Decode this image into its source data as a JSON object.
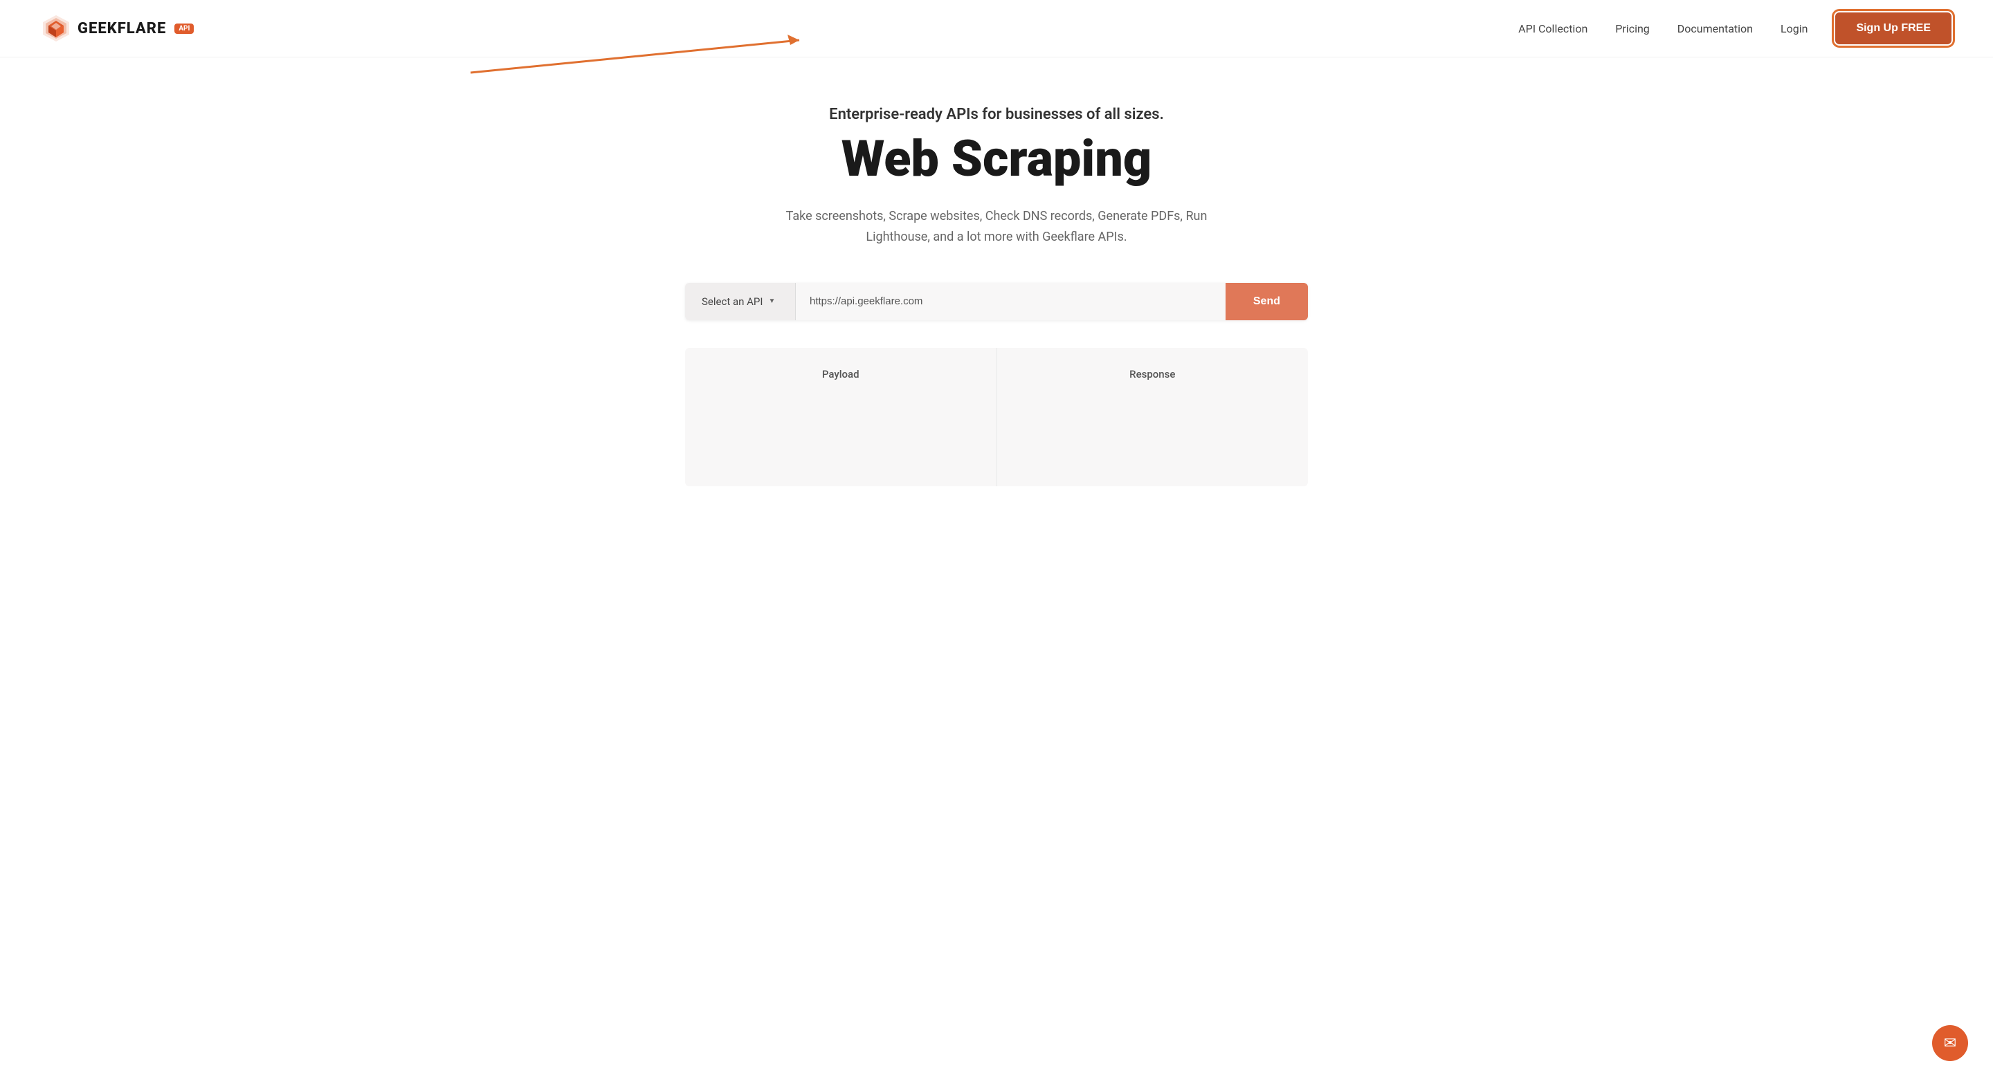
{
  "header": {
    "logo_text": "GEEKFLARE",
    "api_badge": "API",
    "nav": {
      "items": [
        {
          "label": "API Collection",
          "id": "api-collection"
        },
        {
          "label": "Pricing",
          "id": "pricing"
        },
        {
          "label": "Documentation",
          "id": "documentation"
        },
        {
          "label": "Login",
          "id": "login"
        }
      ],
      "signup_label": "Sign Up FREE"
    }
  },
  "hero": {
    "subtitle": "Enterprise-ready APIs for businesses of all sizes.",
    "title": "Web Scraping",
    "description": "Take screenshots, Scrape websites, Check DNS records, Generate PDFs, Run Lighthouse, and a lot more with Geekflare APIs."
  },
  "api_bar": {
    "select_placeholder": "Select an API",
    "url_value": "https://api.geekflare.com",
    "send_label": "Send"
  },
  "panels": {
    "payload_label": "Payload",
    "response_label": "Response"
  },
  "chat_bubble": {
    "icon": "✉"
  }
}
